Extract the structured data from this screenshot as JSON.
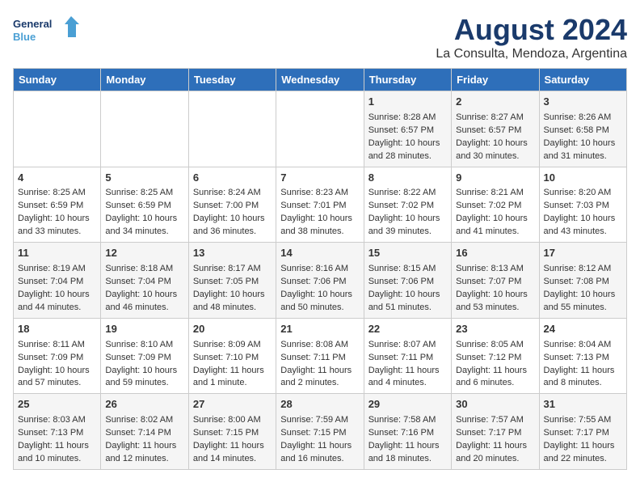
{
  "header": {
    "logo_line1": "General",
    "logo_line2": "Blue",
    "title": "August 2024",
    "subtitle": "La Consulta, Mendoza, Argentina"
  },
  "days_of_week": [
    "Sunday",
    "Monday",
    "Tuesday",
    "Wednesday",
    "Thursday",
    "Friday",
    "Saturday"
  ],
  "weeks": [
    [
      {
        "day": "",
        "content": ""
      },
      {
        "day": "",
        "content": ""
      },
      {
        "day": "",
        "content": ""
      },
      {
        "day": "",
        "content": ""
      },
      {
        "day": "1",
        "content": "Sunrise: 8:28 AM\nSunset: 6:57 PM\nDaylight: 10 hours\nand 28 minutes."
      },
      {
        "day": "2",
        "content": "Sunrise: 8:27 AM\nSunset: 6:57 PM\nDaylight: 10 hours\nand 30 minutes."
      },
      {
        "day": "3",
        "content": "Sunrise: 8:26 AM\nSunset: 6:58 PM\nDaylight: 10 hours\nand 31 minutes."
      }
    ],
    [
      {
        "day": "4",
        "content": "Sunrise: 8:25 AM\nSunset: 6:59 PM\nDaylight: 10 hours\nand 33 minutes."
      },
      {
        "day": "5",
        "content": "Sunrise: 8:25 AM\nSunset: 6:59 PM\nDaylight: 10 hours\nand 34 minutes."
      },
      {
        "day": "6",
        "content": "Sunrise: 8:24 AM\nSunset: 7:00 PM\nDaylight: 10 hours\nand 36 minutes."
      },
      {
        "day": "7",
        "content": "Sunrise: 8:23 AM\nSunset: 7:01 PM\nDaylight: 10 hours\nand 38 minutes."
      },
      {
        "day": "8",
        "content": "Sunrise: 8:22 AM\nSunset: 7:02 PM\nDaylight: 10 hours\nand 39 minutes."
      },
      {
        "day": "9",
        "content": "Sunrise: 8:21 AM\nSunset: 7:02 PM\nDaylight: 10 hours\nand 41 minutes."
      },
      {
        "day": "10",
        "content": "Sunrise: 8:20 AM\nSunset: 7:03 PM\nDaylight: 10 hours\nand 43 minutes."
      }
    ],
    [
      {
        "day": "11",
        "content": "Sunrise: 8:19 AM\nSunset: 7:04 PM\nDaylight: 10 hours\nand 44 minutes."
      },
      {
        "day": "12",
        "content": "Sunrise: 8:18 AM\nSunset: 7:04 PM\nDaylight: 10 hours\nand 46 minutes."
      },
      {
        "day": "13",
        "content": "Sunrise: 8:17 AM\nSunset: 7:05 PM\nDaylight: 10 hours\nand 48 minutes."
      },
      {
        "day": "14",
        "content": "Sunrise: 8:16 AM\nSunset: 7:06 PM\nDaylight: 10 hours\nand 50 minutes."
      },
      {
        "day": "15",
        "content": "Sunrise: 8:15 AM\nSunset: 7:06 PM\nDaylight: 10 hours\nand 51 minutes."
      },
      {
        "day": "16",
        "content": "Sunrise: 8:13 AM\nSunset: 7:07 PM\nDaylight: 10 hours\nand 53 minutes."
      },
      {
        "day": "17",
        "content": "Sunrise: 8:12 AM\nSunset: 7:08 PM\nDaylight: 10 hours\nand 55 minutes."
      }
    ],
    [
      {
        "day": "18",
        "content": "Sunrise: 8:11 AM\nSunset: 7:09 PM\nDaylight: 10 hours\nand 57 minutes."
      },
      {
        "day": "19",
        "content": "Sunrise: 8:10 AM\nSunset: 7:09 PM\nDaylight: 10 hours\nand 59 minutes."
      },
      {
        "day": "20",
        "content": "Sunrise: 8:09 AM\nSunset: 7:10 PM\nDaylight: 11 hours\nand 1 minute."
      },
      {
        "day": "21",
        "content": "Sunrise: 8:08 AM\nSunset: 7:11 PM\nDaylight: 11 hours\nand 2 minutes."
      },
      {
        "day": "22",
        "content": "Sunrise: 8:07 AM\nSunset: 7:11 PM\nDaylight: 11 hours\nand 4 minutes."
      },
      {
        "day": "23",
        "content": "Sunrise: 8:05 AM\nSunset: 7:12 PM\nDaylight: 11 hours\nand 6 minutes."
      },
      {
        "day": "24",
        "content": "Sunrise: 8:04 AM\nSunset: 7:13 PM\nDaylight: 11 hours\nand 8 minutes."
      }
    ],
    [
      {
        "day": "25",
        "content": "Sunrise: 8:03 AM\nSunset: 7:13 PM\nDaylight: 11 hours\nand 10 minutes."
      },
      {
        "day": "26",
        "content": "Sunrise: 8:02 AM\nSunset: 7:14 PM\nDaylight: 11 hours\nand 12 minutes."
      },
      {
        "day": "27",
        "content": "Sunrise: 8:00 AM\nSunset: 7:15 PM\nDaylight: 11 hours\nand 14 minutes."
      },
      {
        "day": "28",
        "content": "Sunrise: 7:59 AM\nSunset: 7:15 PM\nDaylight: 11 hours\nand 16 minutes."
      },
      {
        "day": "29",
        "content": "Sunrise: 7:58 AM\nSunset: 7:16 PM\nDaylight: 11 hours\nand 18 minutes."
      },
      {
        "day": "30",
        "content": "Sunrise: 7:57 AM\nSunset: 7:17 PM\nDaylight: 11 hours\nand 20 minutes."
      },
      {
        "day": "31",
        "content": "Sunrise: 7:55 AM\nSunset: 7:17 PM\nDaylight: 11 hours\nand 22 minutes."
      }
    ]
  ]
}
